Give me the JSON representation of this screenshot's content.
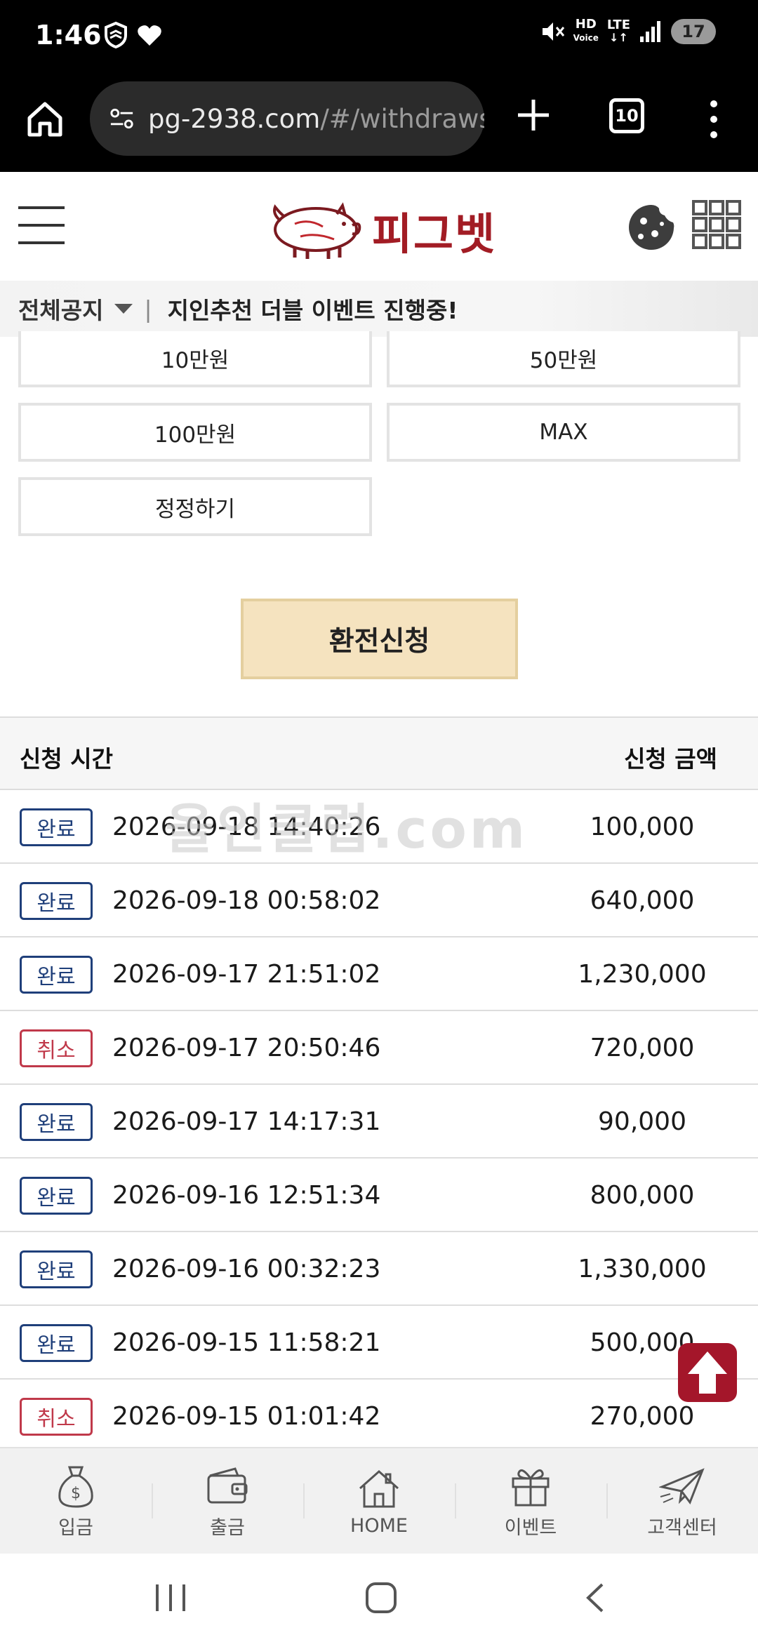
{
  "status": {
    "time": "1:46",
    "battery": "17",
    "network": "LTE",
    "hd": "HD"
  },
  "browser": {
    "url_main": "pg-2938.com",
    "url_path": "/#/withdraws",
    "tab_count": "10"
  },
  "site": {
    "logo_text": "피그벳"
  },
  "notice": {
    "category": "전체공지",
    "separator": "|",
    "text": "지인추천 더블 이벤트 진행중!"
  },
  "amount_buttons": [
    "10만원",
    "50만원",
    "100만원",
    "MAX",
    "정정하기"
  ],
  "submit_label": "환전신청",
  "table": {
    "header_time": "신청 시간",
    "header_amount": "신청 금액",
    "rows": [
      {
        "status": "완료",
        "time": "2026-09-18 14:40:26",
        "amount": "100,000"
      },
      {
        "status": "완료",
        "time": "2026-09-18 00:58:02",
        "amount": "640,000"
      },
      {
        "status": "완료",
        "time": "2026-09-17 21:51:02",
        "amount": "1,230,000"
      },
      {
        "status": "취소",
        "time": "2026-09-17 20:50:46",
        "amount": "720,000"
      },
      {
        "status": "완료",
        "time": "2026-09-17 14:17:31",
        "amount": "90,000"
      },
      {
        "status": "완료",
        "time": "2026-09-16 12:51:34",
        "amount": "800,000"
      },
      {
        "status": "완료",
        "time": "2026-09-16 00:32:23",
        "amount": "1,330,000"
      },
      {
        "status": "완료",
        "time": "2026-09-15 11:58:21",
        "amount": "500,000"
      },
      {
        "status": "취소",
        "time": "2026-09-15 01:01:42",
        "amount": "270,000"
      }
    ]
  },
  "watermark": "올인클럽.com",
  "bottom_nav": [
    {
      "label": "입금",
      "icon": "money-bag-icon"
    },
    {
      "label": "출금",
      "icon": "wallet-icon"
    },
    {
      "label": "HOME",
      "icon": "house-icon"
    },
    {
      "label": "이벤트",
      "icon": "gift-icon"
    },
    {
      "label": "고객센터",
      "icon": "paper-plane-icon"
    }
  ],
  "colors": {
    "done": "#1f3f7a",
    "cancel": "#c0394a",
    "brand": "#a21c24",
    "submit_bg": "#f5e3bf"
  }
}
